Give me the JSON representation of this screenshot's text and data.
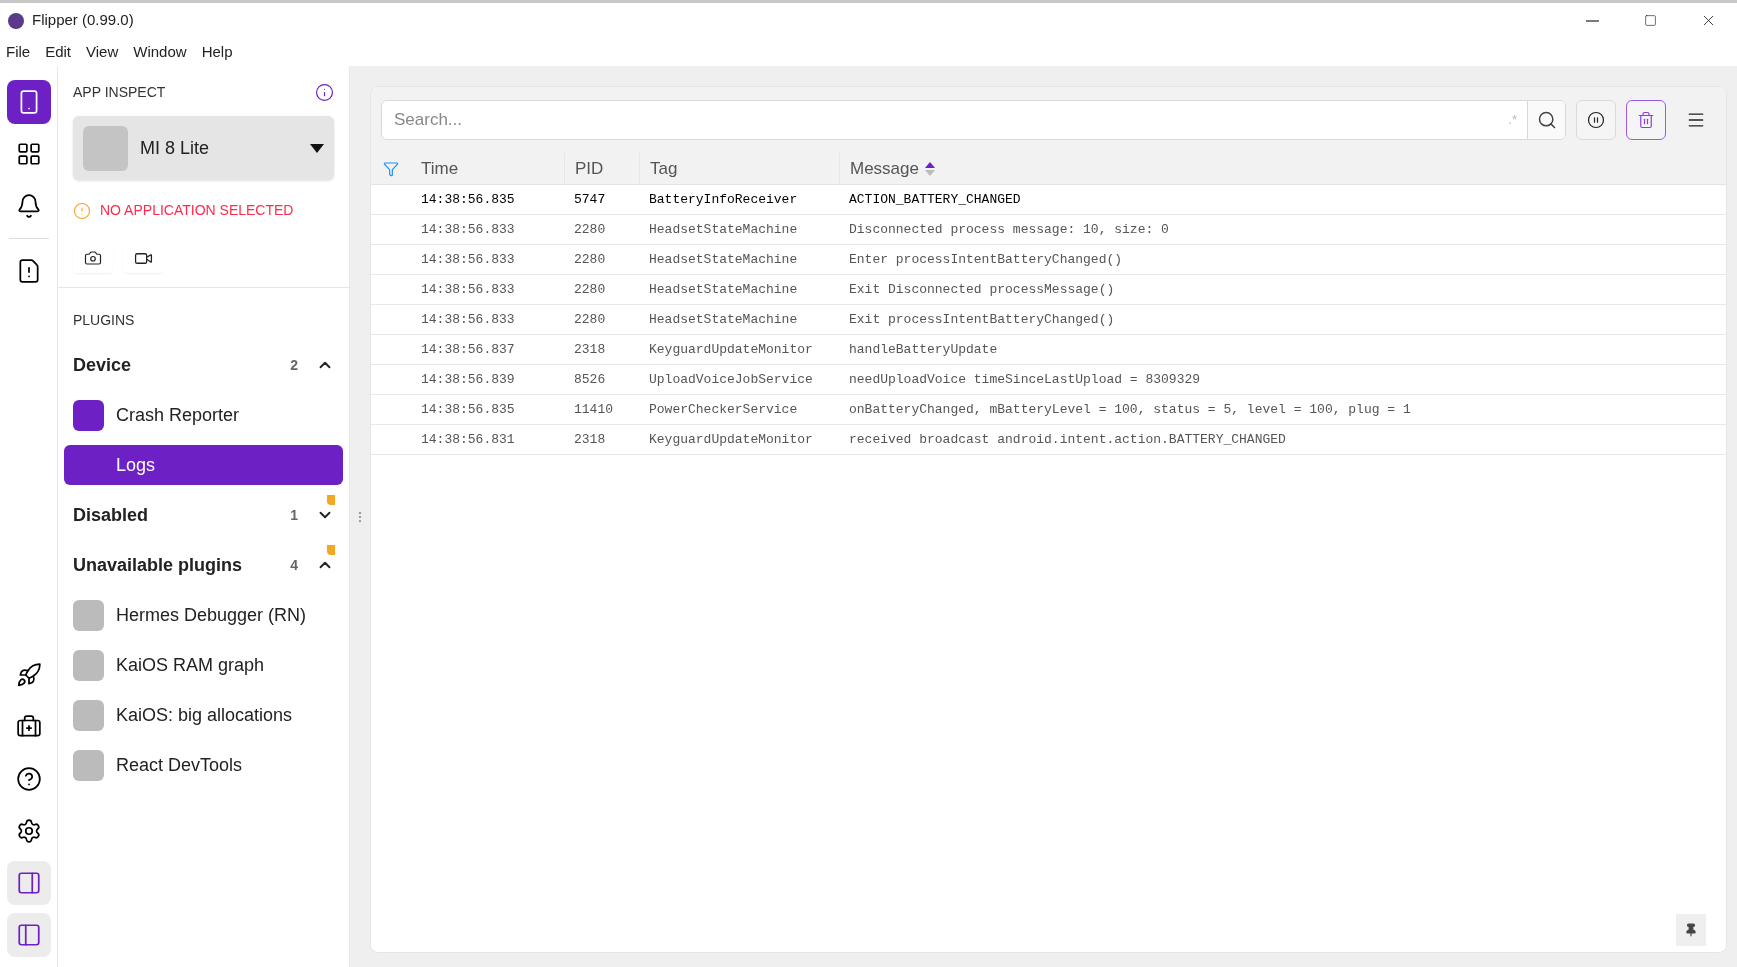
{
  "window": {
    "title": "Flipper (0.99.0)"
  },
  "menu": [
    "File",
    "Edit",
    "View",
    "Window",
    "Help"
  ],
  "rail": {
    "top": [
      {
        "selected": true
      },
      {
        "selected": false
      },
      {
        "selected": false
      },
      {
        "selected": false
      }
    ],
    "bottom": [
      {
        "on": false
      },
      {
        "on": false
      },
      {
        "on": false
      },
      {
        "on": false
      },
      {
        "on": true
      },
      {
        "on": true
      }
    ]
  },
  "sidebar": {
    "header": "APP INSPECT",
    "device": "MI 8 Lite",
    "warning": "NO APPLICATION SELECTED",
    "plugins_title": "PLUGINS",
    "groups": [
      {
        "label": "Device",
        "count": "2",
        "expanded": true,
        "notice": false,
        "plugins": [
          {
            "label": "Crash Reporter",
            "color": "#6d21c4",
            "selected": false
          },
          {
            "label": "Logs",
            "selected": true
          }
        ]
      },
      {
        "label": "Disabled",
        "count": "1",
        "expanded": false,
        "notice": true
      },
      {
        "label": "Unavailable plugins",
        "count": "4",
        "expanded": true,
        "notice": true,
        "plugins": [
          {
            "label": "Hermes Debugger (RN)",
            "color": "#bbbbbb",
            "selected": false
          },
          {
            "label": "KaiOS RAM graph",
            "color": "#bbbbbb",
            "selected": false
          },
          {
            "label": "KaiOS: big allocations",
            "color": "#bbbbbb",
            "selected": false
          },
          {
            "label": "React DevTools",
            "color": "#bbbbbb",
            "selected": false
          }
        ]
      }
    ]
  },
  "search": {
    "placeholder": "Search...",
    "regex_marker": ".*"
  },
  "table": {
    "columns": [
      {
        "label": "Time",
        "sorted": false
      },
      {
        "label": "PID",
        "sorted": false
      },
      {
        "label": "Tag",
        "sorted": false
      },
      {
        "label": "Message",
        "sorted": true
      }
    ],
    "rows": [
      {
        "selected": true,
        "cells": [
          "14:38:56.835",
          "5747",
          "BatteryInfoReceiver",
          "ACTION_BATTERY_CHANGED"
        ]
      },
      {
        "selected": false,
        "cells": [
          "14:38:56.833",
          "2280",
          "HeadsetStateMachine",
          "Disconnected process message: 10, size: 0"
        ]
      },
      {
        "selected": false,
        "cells": [
          "14:38:56.833",
          "2280",
          "HeadsetStateMachine",
          "Enter processIntentBatteryChanged()"
        ]
      },
      {
        "selected": false,
        "cells": [
          "14:38:56.833",
          "2280",
          "HeadsetStateMachine",
          "Exit Disconnected processMessage()"
        ]
      },
      {
        "selected": false,
        "cells": [
          "14:38:56.833",
          "2280",
          "HeadsetStateMachine",
          "Exit processIntentBatteryChanged()"
        ]
      },
      {
        "selected": false,
        "cells": [
          "14:38:56.837",
          "2318",
          "KeyguardUpdateMonitor",
          "handleBatteryUpdate"
        ]
      },
      {
        "selected": false,
        "cells": [
          "14:38:56.839",
          "8526",
          "UploadVoiceJobService",
          "needUploadVoice timeSinceLastUpload = 8309329"
        ]
      },
      {
        "selected": false,
        "cells": [
          "14:38:56.835",
          "11410",
          "PowerCheckerService",
          "onBatteryChanged, mBatteryLevel = 100, status = 5, level = 100, plug = 1"
        ]
      },
      {
        "selected": false,
        "cells": [
          "14:38:56.831",
          "2318",
          "KeyguardUpdateMonitor",
          "received broadcast android.intent.action.BATTERY_CHANGED"
        ]
      }
    ]
  }
}
